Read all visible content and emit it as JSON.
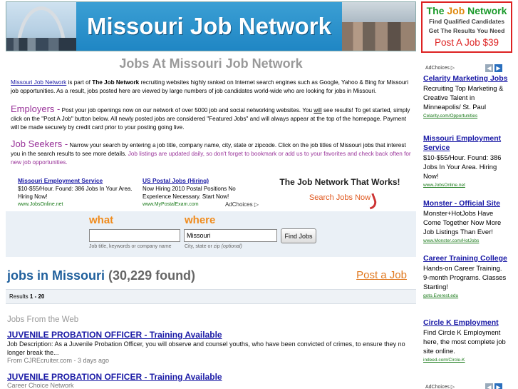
{
  "banner": {
    "title": "Missouri Job Network"
  },
  "page_title": "Jobs At Missouri Job Network",
  "intro": {
    "link": "Missouri Job Network",
    "text1": " is part of ",
    "bold": "The Job Network",
    "text2": " recruiting websites highly ranked on Internet search engines such as Google, Yahoo & Bing for Missouri job opportunities. As a result, jobs posted here are viewed by large numbers of job candidates world-wide who are looking for jobs in Missouri."
  },
  "employers": {
    "heading": "Employers -",
    "text1": " Post your job openings now on our network of over 5000 job and social networking websites. You ",
    "will": "will",
    "text2": " see results! To get started, simply click on the \"Post A Job\" button below. All newly posted jobs are considered \"Featured Jobs\" and will always appear at the top of the homepage. Payment will be made securely by credit card prior to your posting going live."
  },
  "seekers": {
    "heading": "Job Seekers -",
    "text1": " Narrow your search by entering a job title, company name, city, state or zipcode. Click on the job titles of Missouri jobs that interest you in the search results to see more details. ",
    "text2": "Job listings are updated daily, so don't forget to bookmark or add us to your favorites and check back often for new job opportunities."
  },
  "inline_ads": [
    {
      "title": "Missouri Employment Service",
      "body": "$10-$55/Hour. Found: 386 Jobs In Your Area. Hiring Now!",
      "url": "www.JobsOnline.net"
    },
    {
      "title": "US Postal Jobs (Hiring)",
      "body": "Now Hiring 2010 Postal Positions No Experience Necessary. Start Now!",
      "url": "www.MyPostalExam.com"
    }
  ],
  "adchoices": "AdChoices ▷",
  "promo": {
    "headline": "The Job Network That Works!",
    "link": "Search Jobs Now"
  },
  "search": {
    "what_label": "what",
    "where_label": "where",
    "what_value": "",
    "where_value": "Missouri",
    "what_hint": "Job title, keywords or company name",
    "where_hint_prefix": "City, state or zip ",
    "where_hint_opt": "(optional)",
    "button": "Find Jobs"
  },
  "results": {
    "heading": "jobs in Missouri",
    "count": "(30,229 found)",
    "post_job": "Post a Job",
    "range_prefix": "Results ",
    "range": "1 - 20"
  },
  "web_heading": "Jobs From the Web",
  "jobs": [
    {
      "title": "JUVENILE PROBATION OFFICER - Training Available",
      "desc": "Job Description: As a Juvenile Probation Officer, you will observe and counsel youths, who have been convicted of crimes, to ensure they no longer break the...",
      "meta": "From CJREcruiter.com - 3 days ago"
    },
    {
      "title": "JUVENILE PROBATION OFFICER - Training Available",
      "desc": "",
      "meta": "Career Choice Network"
    }
  ],
  "sidebar": {
    "tjn": {
      "the": "The ",
      "job": "Job",
      "network": " Network",
      "line2": "Find Qualified Candidates",
      "line3": "Get The Results You Need",
      "cta": "Post A Job $39"
    },
    "nav_prev": "◀",
    "nav_next": "▶",
    "ads": [
      {
        "title": "Celarity Marketing Jobs",
        "body": "Recruiting Top Marketing & Creative Talent in Minneapolis/ St. Paul",
        "url": "Celarity.com/Opportunities"
      },
      {
        "title": "Missouri Employment Service",
        "body": "$10-$55/Hour. Found: 386 Jobs In Your Area. Hiring Now!",
        "url": "www.JobsOnline.net"
      },
      {
        "title": "Monster - Official Site",
        "body": "Monster+HotJobs Have Come Together Now More Job Listings Than Ever!",
        "url": "www.Monster.com/HotJobs"
      },
      {
        "title": "Career Training College",
        "body": "Hands-on Career Training. 9-month Programs. Classes Starting!",
        "url": "goto.Everest.edu"
      },
      {
        "title": "Circle K Employment",
        "body": "Find Circle K Employment here, the most complete job site online.",
        "url": "indeed.com/Circle-K"
      }
    ]
  }
}
